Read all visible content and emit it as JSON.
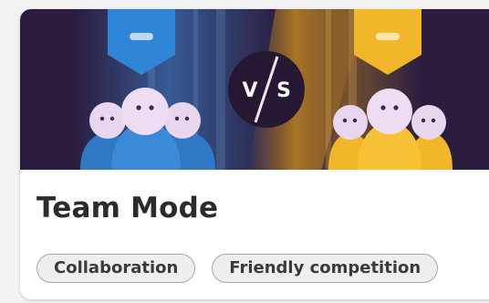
{
  "card": {
    "title": "Team Mode",
    "tags": [
      {
        "label": "Collaboration"
      },
      {
        "label": "Friendly competition"
      }
    ],
    "banner": {
      "versus_text_left": "V",
      "versus_text_right": "S"
    }
  },
  "colors": {
    "banner_bg": "#2b1d3f",
    "team_blue": "#2f78c4",
    "team_yellow": "#f2b62a",
    "face": "#e7d6ee"
  }
}
